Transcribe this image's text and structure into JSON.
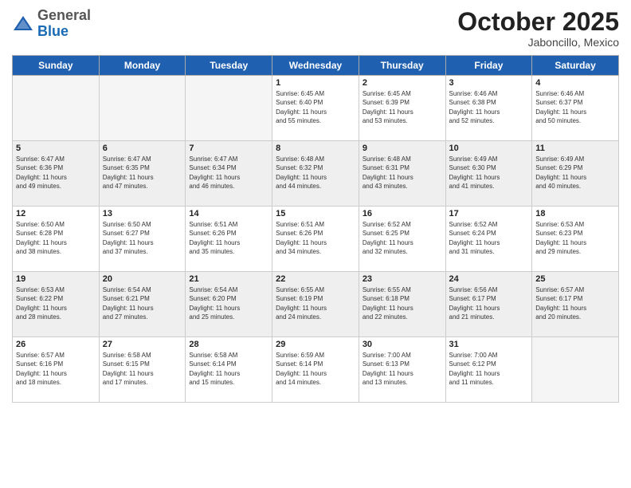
{
  "header": {
    "logo_general": "General",
    "logo_blue": "Blue",
    "month_title": "October 2025",
    "subtitle": "Jaboncillo, Mexico"
  },
  "days_of_week": [
    "Sunday",
    "Monday",
    "Tuesday",
    "Wednesday",
    "Thursday",
    "Friday",
    "Saturday"
  ],
  "weeks": [
    [
      {
        "day": "",
        "info": ""
      },
      {
        "day": "",
        "info": ""
      },
      {
        "day": "",
        "info": ""
      },
      {
        "day": "1",
        "info": "Sunrise: 6:45 AM\nSunset: 6:40 PM\nDaylight: 11 hours\nand 55 minutes."
      },
      {
        "day": "2",
        "info": "Sunrise: 6:45 AM\nSunset: 6:39 PM\nDaylight: 11 hours\nand 53 minutes."
      },
      {
        "day": "3",
        "info": "Sunrise: 6:46 AM\nSunset: 6:38 PM\nDaylight: 11 hours\nand 52 minutes."
      },
      {
        "day": "4",
        "info": "Sunrise: 6:46 AM\nSunset: 6:37 PM\nDaylight: 11 hours\nand 50 minutes."
      }
    ],
    [
      {
        "day": "5",
        "info": "Sunrise: 6:47 AM\nSunset: 6:36 PM\nDaylight: 11 hours\nand 49 minutes."
      },
      {
        "day": "6",
        "info": "Sunrise: 6:47 AM\nSunset: 6:35 PM\nDaylight: 11 hours\nand 47 minutes."
      },
      {
        "day": "7",
        "info": "Sunrise: 6:47 AM\nSunset: 6:34 PM\nDaylight: 11 hours\nand 46 minutes."
      },
      {
        "day": "8",
        "info": "Sunrise: 6:48 AM\nSunset: 6:32 PM\nDaylight: 11 hours\nand 44 minutes."
      },
      {
        "day": "9",
        "info": "Sunrise: 6:48 AM\nSunset: 6:31 PM\nDaylight: 11 hours\nand 43 minutes."
      },
      {
        "day": "10",
        "info": "Sunrise: 6:49 AM\nSunset: 6:30 PM\nDaylight: 11 hours\nand 41 minutes."
      },
      {
        "day": "11",
        "info": "Sunrise: 6:49 AM\nSunset: 6:29 PM\nDaylight: 11 hours\nand 40 minutes."
      }
    ],
    [
      {
        "day": "12",
        "info": "Sunrise: 6:50 AM\nSunset: 6:28 PM\nDaylight: 11 hours\nand 38 minutes."
      },
      {
        "day": "13",
        "info": "Sunrise: 6:50 AM\nSunset: 6:27 PM\nDaylight: 11 hours\nand 37 minutes."
      },
      {
        "day": "14",
        "info": "Sunrise: 6:51 AM\nSunset: 6:26 PM\nDaylight: 11 hours\nand 35 minutes."
      },
      {
        "day": "15",
        "info": "Sunrise: 6:51 AM\nSunset: 6:26 PM\nDaylight: 11 hours\nand 34 minutes."
      },
      {
        "day": "16",
        "info": "Sunrise: 6:52 AM\nSunset: 6:25 PM\nDaylight: 11 hours\nand 32 minutes."
      },
      {
        "day": "17",
        "info": "Sunrise: 6:52 AM\nSunset: 6:24 PM\nDaylight: 11 hours\nand 31 minutes."
      },
      {
        "day": "18",
        "info": "Sunrise: 6:53 AM\nSunset: 6:23 PM\nDaylight: 11 hours\nand 29 minutes."
      }
    ],
    [
      {
        "day": "19",
        "info": "Sunrise: 6:53 AM\nSunset: 6:22 PM\nDaylight: 11 hours\nand 28 minutes."
      },
      {
        "day": "20",
        "info": "Sunrise: 6:54 AM\nSunset: 6:21 PM\nDaylight: 11 hours\nand 27 minutes."
      },
      {
        "day": "21",
        "info": "Sunrise: 6:54 AM\nSunset: 6:20 PM\nDaylight: 11 hours\nand 25 minutes."
      },
      {
        "day": "22",
        "info": "Sunrise: 6:55 AM\nSunset: 6:19 PM\nDaylight: 11 hours\nand 24 minutes."
      },
      {
        "day": "23",
        "info": "Sunrise: 6:55 AM\nSunset: 6:18 PM\nDaylight: 11 hours\nand 22 minutes."
      },
      {
        "day": "24",
        "info": "Sunrise: 6:56 AM\nSunset: 6:17 PM\nDaylight: 11 hours\nand 21 minutes."
      },
      {
        "day": "25",
        "info": "Sunrise: 6:57 AM\nSunset: 6:17 PM\nDaylight: 11 hours\nand 20 minutes."
      }
    ],
    [
      {
        "day": "26",
        "info": "Sunrise: 6:57 AM\nSunset: 6:16 PM\nDaylight: 11 hours\nand 18 minutes."
      },
      {
        "day": "27",
        "info": "Sunrise: 6:58 AM\nSunset: 6:15 PM\nDaylight: 11 hours\nand 17 minutes."
      },
      {
        "day": "28",
        "info": "Sunrise: 6:58 AM\nSunset: 6:14 PM\nDaylight: 11 hours\nand 15 minutes."
      },
      {
        "day": "29",
        "info": "Sunrise: 6:59 AM\nSunset: 6:14 PM\nDaylight: 11 hours\nand 14 minutes."
      },
      {
        "day": "30",
        "info": "Sunrise: 7:00 AM\nSunset: 6:13 PM\nDaylight: 11 hours\nand 13 minutes."
      },
      {
        "day": "31",
        "info": "Sunrise: 7:00 AM\nSunset: 6:12 PM\nDaylight: 11 hours\nand 11 minutes."
      },
      {
        "day": "",
        "info": ""
      }
    ]
  ]
}
